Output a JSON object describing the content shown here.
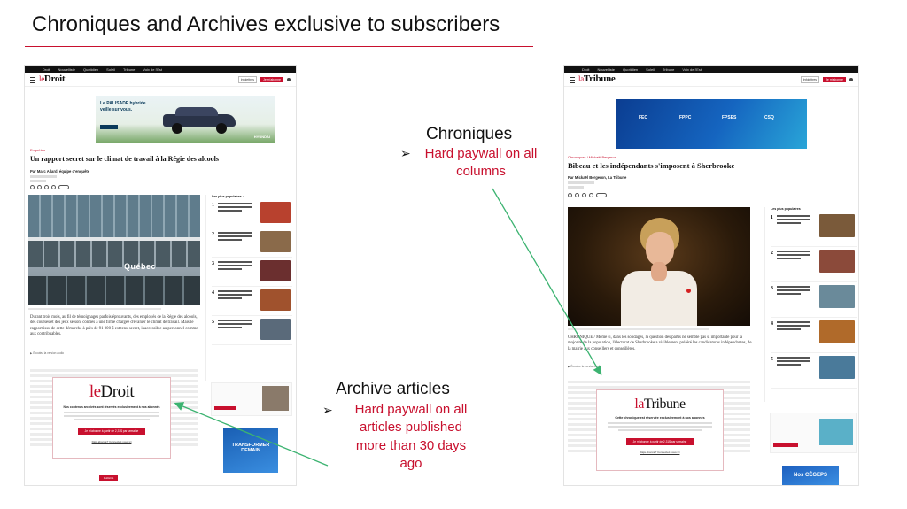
{
  "slide": {
    "title": "Chroniques and Archives exclusive to subscribers"
  },
  "annotations": {
    "chroniques": {
      "heading": "Chroniques",
      "bullet": "Hard paywall on all columns",
      "line1": "Hard paywall on all",
      "line2": "columns"
    },
    "archives": {
      "heading": "Archive articles",
      "line1": "Hard paywall on all",
      "line2": "articles published",
      "line3": "more than 30 days",
      "line4": "ago"
    },
    "bullet_glyph": "➢",
    "arrow_color": "#3cb371"
  },
  "ledroit": {
    "logo_pre": "le",
    "logo_name": "Droit",
    "topbar": [
      "Droit",
      "Nouvelliste",
      "Quotidien",
      "Soleil",
      "Tribune",
      "Voix de l'Est"
    ],
    "header_btn": "Infolettres",
    "subscribe_btn": "Je m'abonne",
    "ad_headline": "Le PALISADE hybride",
    "ad_sub": "veille sur vous.",
    "ad_brand": "HYUNDAI",
    "category": "Enquêtes",
    "headline": "Un rapport secret sur le climat de travail à la Régie des alcools",
    "byline": "Par Marc Allard, équipe d'enquête",
    "photo_sign": "Québec",
    "lede": "Durant trois mois, au fil de témoignages parfois éprouvants, des employés de la Régie des alcools, des courses et des jeux se sont confiés à une firme chargée d'évaluer le climat de travail. Mais le rapport issu de cette démarche à près de 91 000 $ est tenu secret, inaccessible au personnel comme aux contribuables.",
    "audio": "Écoutez la version audio",
    "sidebar_title": "Les plus populaires :",
    "sidebar_colors": [
      "#b8412e",
      "#8a6a4a",
      "#6b2f2f",
      "#a0522d",
      "#5a6a7a"
    ],
    "paywall_head": "Nos contenus archivés sont réservés exclusivement à nos abonnés",
    "paywall_cta": "Je m'abonne à partir de 2,31$ par semaine",
    "paywall_link": "Déjà abonné? Connectez-vous ici",
    "bottom_btn": "Publicité",
    "bottom_ad_title": "TRANSFORMER DEMAIN"
  },
  "latribune": {
    "logo_pre": "la",
    "logo_name": "Tribune",
    "topbar": [
      "Droit",
      "Nouvelliste",
      "Quotidien",
      "Soleil",
      "Tribune",
      "Voix de l'Est"
    ],
    "header_btn": "Infolettres",
    "subscribe_btn": "Je m'abonne",
    "ad_logos": [
      "FEC",
      "FPPC",
      "FPSES",
      "CSQ"
    ],
    "category": "Chroniques / Mickaël Bergeron",
    "headline": "Bibeau et les indépendants s'imposent à Sherbrooke",
    "byline": "Par Mickaël Bergeron, La Tribune",
    "lede": "CHRONIQUE / Même si, dans les sondages, la question des partis ne semble pas si importante pour la majorité de la population, l'électorat de Sherbrooke a visiblement préféré les candidatures indépendantes, de la mairie aux conseillers et conseillères.",
    "audio": "Écoutez la version audio",
    "sidebar_title": "Les plus populaires :",
    "sidebar_colors": [
      "#7a5a3a",
      "#8b4a3a",
      "#6a8a9a",
      "#b06a2a",
      "#4a7a9a"
    ],
    "paywall_head": "Cette chronique est réservée exclusivement à nos abonnés",
    "paywall_cta": "Je m'abonne à partir de 2,31$ par semaine",
    "paywall_link": "Déjà abonné? Connectez-vous ici",
    "bottom_ad_title": "Nos CÉGEPS"
  }
}
